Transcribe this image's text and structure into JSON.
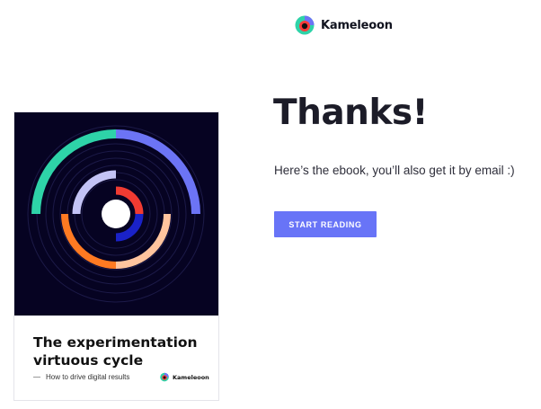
{
  "brand": {
    "name": "Kameleoon",
    "logo_icon": "kameleoon-logo-icon"
  },
  "ebook": {
    "title": "The experimentation\nvirtuous cycle",
    "subtitle": "How to drive digital results",
    "brand_name": "Kameleoon",
    "cover_colors": [
      "#2ed3a8",
      "#6c74f5",
      "#ff7a22",
      "#ffc49e",
      "#c3c3f5",
      "#f03b32",
      "#1a22c8"
    ]
  },
  "main": {
    "heading": "Thanks!",
    "message": "Here’s the ebook, you’ll also get it by email :)",
    "cta_label": "START READING"
  }
}
